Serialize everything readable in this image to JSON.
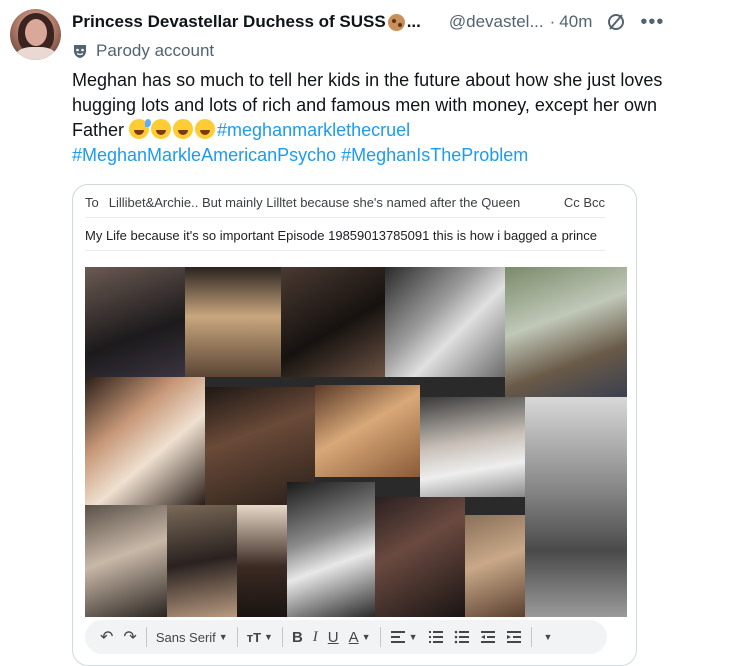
{
  "author": {
    "display_name": "Princess Devastellar Duchess of SUSS",
    "truncation": "...",
    "handle": "@devastel...",
    "separator": "·",
    "time": "40m",
    "badge": "Parody account"
  },
  "tweet": {
    "line1": "Meghan has so much to tell her kids in the future about how she just loves",
    "line2": "hugging lots and lots of rich and famous men with money, except her own",
    "line3_text": "Father ",
    "hashtag1": "#meghanmarklethecruel",
    "hashtag2": "#MeghanMarkleAmericanPsycho",
    "hashtag3": "#MeghanIsTheProblem"
  },
  "email": {
    "to_label": "To",
    "to_value": "Lillibet&Archie.. But mainly Lilltet because she's named after the Queen",
    "cc_bcc": "Cc Bcc",
    "subject": "My Life because it's so important Episode 19859013785091 this is how i bagged a prince"
  },
  "toolbar": {
    "undo": "↶",
    "redo": "↷",
    "font": "Sans Serif",
    "size": "тT",
    "bold": "B",
    "italic": "I",
    "underline": "U",
    "text_color": "A"
  },
  "colors": {
    "link": "#1d9bf0",
    "muted": "#536471",
    "border": "#cfd9de",
    "toolbar_bg": "#f1f3f4"
  }
}
